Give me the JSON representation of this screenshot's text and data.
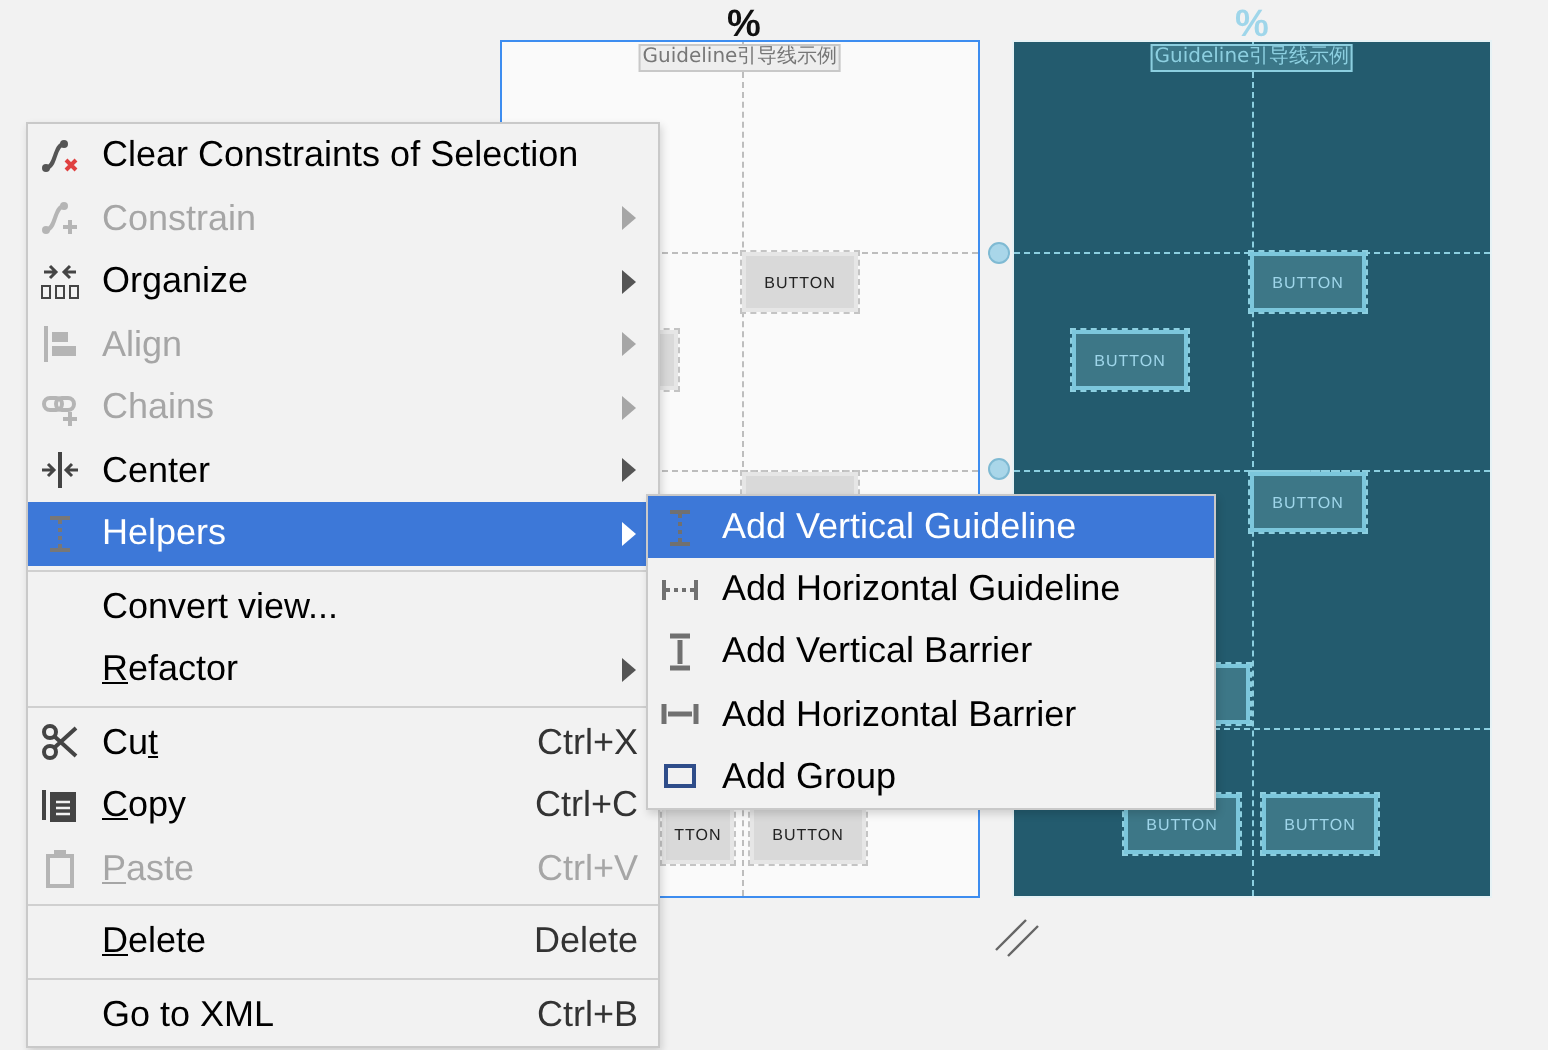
{
  "design_view": {
    "marker": "%",
    "title": "Guideline引导线示例",
    "buttons": [
      "BUTTON",
      "TTON",
      "BUTTON"
    ]
  },
  "blueprint_view": {
    "marker": "%",
    "title": "Guideline引导线示例",
    "buttons": [
      "BUTTON",
      "BUTTON",
      "BUTTON",
      "BUTTON",
      "BUTTON"
    ]
  },
  "context_menu": {
    "items": [
      {
        "kind": "item",
        "label": "Clear Constraints of Selection",
        "disabled": false,
        "selected": false,
        "submenu": false
      },
      {
        "kind": "item",
        "label": "Constrain",
        "disabled": true,
        "selected": false,
        "submenu": true
      },
      {
        "kind": "item",
        "label": "Organize",
        "disabled": false,
        "selected": false,
        "submenu": true
      },
      {
        "kind": "item",
        "label": "Align",
        "disabled": true,
        "selected": false,
        "submenu": true
      },
      {
        "kind": "item",
        "label": "Chains",
        "disabled": true,
        "selected": false,
        "submenu": true
      },
      {
        "kind": "item",
        "label": "Center",
        "disabled": false,
        "selected": false,
        "submenu": true
      },
      {
        "kind": "item",
        "label": "Helpers",
        "disabled": false,
        "selected": true,
        "submenu": true
      },
      {
        "kind": "separator"
      },
      {
        "kind": "item",
        "label": "Convert view...",
        "disabled": false,
        "selected": false,
        "submenu": false
      },
      {
        "kind": "item",
        "mnemonic": "R",
        "label_after": "efactor",
        "disabled": false,
        "selected": false,
        "submenu": true
      },
      {
        "kind": "separator"
      },
      {
        "kind": "item",
        "label_before": "Cu",
        "mnemonic": "t",
        "shortcut": "Ctrl+X",
        "disabled": false,
        "selected": false,
        "submenu": false
      },
      {
        "kind": "item",
        "mnemonic": "C",
        "label_after": "opy",
        "shortcut": "Ctrl+C",
        "disabled": false,
        "selected": false,
        "submenu": false
      },
      {
        "kind": "item",
        "mnemonic": "P",
        "label_after": "aste",
        "shortcut": "Ctrl+V",
        "disabled": true,
        "selected": false,
        "submenu": false
      },
      {
        "kind": "separator"
      },
      {
        "kind": "item",
        "mnemonic": "D",
        "label_after": "elete",
        "shortcut": "Delete",
        "disabled": false,
        "selected": false,
        "submenu": false
      },
      {
        "kind": "separator"
      },
      {
        "kind": "item",
        "label": "Go to XML",
        "shortcut": "Ctrl+B",
        "disabled": false,
        "selected": false,
        "submenu": false
      }
    ]
  },
  "helpers_submenu": {
    "items": [
      {
        "label": "Add Vertical Guideline",
        "selected": true
      },
      {
        "label": "Add Horizontal Guideline",
        "selected": false
      },
      {
        "label": "Add Vertical Barrier",
        "selected": false
      },
      {
        "label": "Add Horizontal Barrier",
        "selected": false
      },
      {
        "label": "Add Group",
        "selected": false
      }
    ]
  }
}
